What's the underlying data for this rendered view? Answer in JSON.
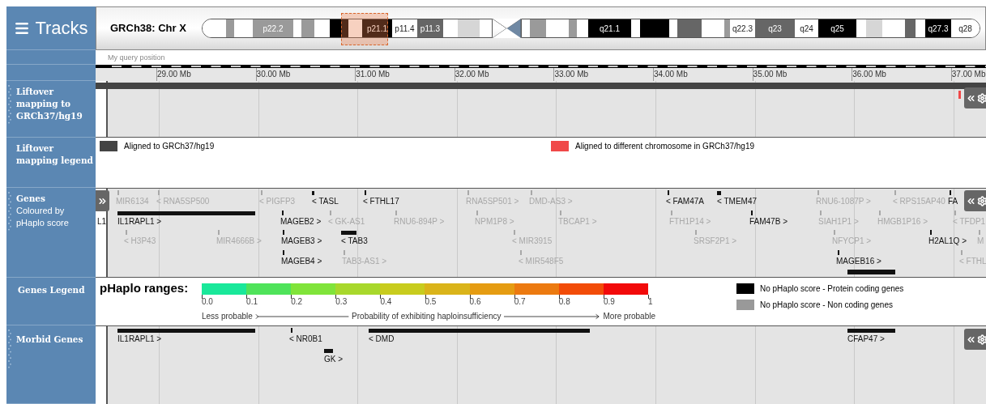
{
  "sidebar": {
    "title": "Tracks"
  },
  "header": {
    "assembly": "GRCh38: Chr X",
    "p_arm": [
      {
        "kind": "gneg"
      },
      {
        "kind": "gpos50"
      },
      {
        "kind": "gneg"
      },
      {
        "kind": "gpos50",
        "label": "p22.2"
      },
      {
        "kind": "gneg"
      },
      {
        "kind": "gpos50"
      },
      {
        "kind": "gneg"
      },
      {
        "kind": "gpos100"
      },
      {
        "kind": "gneg"
      },
      {
        "kind": "gpos100",
        "label": "p21.1"
      },
      {
        "kind": "gneg",
        "label": "p11.4"
      },
      {
        "kind": "gpos75",
        "label": "p11.3"
      },
      {
        "kind": "gneg"
      },
      {
        "kind": "gpos25"
      },
      {
        "kind": "gneg"
      }
    ],
    "q_arm": [
      {
        "kind": "gneg"
      },
      {
        "kind": "gpos50"
      },
      {
        "kind": "gneg"
      },
      {
        "kind": "gpos50"
      },
      {
        "kind": "gneg"
      },
      {
        "kind": "gpos100",
        "label": "q21.1"
      },
      {
        "kind": "gneg"
      },
      {
        "kind": "gpos100"
      },
      {
        "kind": "gneg"
      },
      {
        "kind": "gpos75"
      },
      {
        "kind": "gneg"
      },
      {
        "kind": "gpos50"
      },
      {
        "kind": "gneg",
        "label": "q22.3"
      },
      {
        "kind": "gpos75",
        "label": "q23"
      },
      {
        "kind": "gneg",
        "label": "q24"
      },
      {
        "kind": "gpos100",
        "label": "q25"
      },
      {
        "kind": "gneg"
      },
      {
        "kind": "gpos25"
      },
      {
        "kind": "gneg"
      },
      {
        "kind": "gpos75"
      },
      {
        "kind": "gneg"
      },
      {
        "kind": "gpos100",
        "label": "q27.3"
      },
      {
        "kind": "gneg",
        "label": "q28"
      }
    ]
  },
  "query_label": "My query position",
  "ruler": {
    "ticks": [
      "29.00 Mb",
      "30.00 Mb",
      "31.00 Mb",
      "32.00 Mb",
      "33.00 Mb",
      "34.00 Mb",
      "35.00 Mb",
      "36.00 Mb",
      "37.00 Mb"
    ]
  },
  "liftover": {
    "title": "Liftover mapping to GRCh37/hg19"
  },
  "liftover_legend": {
    "title": "Liftover mapping legend",
    "items": [
      {
        "label": "Aligned to GRCh37/hg19",
        "color": "#444444"
      },
      {
        "label": "Aligned to different chromosome in GRCh37/hg19",
        "color": "#f04848"
      }
    ]
  },
  "genes": {
    "title": "Genes",
    "subtitle": "Coloured by pHaplo score",
    "items": [
      {
        "label": "MIR6134",
        "kind": "noncoding"
      },
      {
        "label": "< RNA5SP500",
        "kind": "noncoding"
      },
      {
        "label": "< PIGFP3",
        "kind": "noncoding"
      },
      {
        "label": "< TASL",
        "kind": "coding"
      },
      {
        "label": "< FTHL17",
        "kind": "coding"
      },
      {
        "label": "RNA5SP501 >",
        "kind": "noncoding"
      },
      {
        "label": "DMD-AS3 >",
        "kind": "noncoding"
      },
      {
        "label": "< FAM47A",
        "kind": "coding"
      },
      {
        "label": "< TMEM47",
        "kind": "coding"
      },
      {
        "label": "RNU6-1087P >",
        "kind": "noncoding"
      },
      {
        "label": "< RPS15AP40",
        "kind": "noncoding"
      },
      {
        "label": "FA",
        "kind": "coding"
      },
      {
        "label": "L1",
        "kind": "coding"
      },
      {
        "label": "IL1RAPL1 >",
        "kind": "coding"
      },
      {
        "label": "MAGEB2 >",
        "kind": "coding"
      },
      {
        "label": "< GK-AS1",
        "kind": "noncoding"
      },
      {
        "label": "RNU6-894P >",
        "kind": "noncoding"
      },
      {
        "label": "NPM1P8 >",
        "kind": "noncoding"
      },
      {
        "label": "TBCAP1 >",
        "kind": "noncoding"
      },
      {
        "label": "FTH1P14 >",
        "kind": "noncoding"
      },
      {
        "label": "FAM47B >",
        "kind": "coding"
      },
      {
        "label": "SIAH1P1 >",
        "kind": "noncoding"
      },
      {
        "label": "HMGB1P16 >",
        "kind": "noncoding"
      },
      {
        "label": "< TFDP1",
        "kind": "noncoding"
      },
      {
        "label": "< H3P43",
        "kind": "noncoding"
      },
      {
        "label": "MIR4666B >",
        "kind": "noncoding"
      },
      {
        "label": "MAGEB3 >",
        "kind": "coding"
      },
      {
        "label": "< TAB3",
        "kind": "coding"
      },
      {
        "label": "< MIR3915",
        "kind": "noncoding"
      },
      {
        "label": "SRSF2P1 >",
        "kind": "noncoding"
      },
      {
        "label": "NFYCP1 >",
        "kind": "noncoding"
      },
      {
        "label": "H2AL1Q >",
        "kind": "coding"
      },
      {
        "label": "M",
        "kind": "noncoding"
      },
      {
        "label": "MAGEB4 >",
        "kind": "coding"
      },
      {
        "label": "TAB3-AS1 >",
        "kind": "noncoding"
      },
      {
        "label": "< MIR548F5",
        "kind": "noncoding"
      },
      {
        "label": "MAGEB16 >",
        "kind": "coding"
      },
      {
        "label": "< FTHL",
        "kind": "noncoding"
      }
    ]
  },
  "genes_legend": {
    "title": "Genes Legend",
    "heading": "pHaplo ranges:",
    "ranges": [
      {
        "color": "#19e89a"
      },
      {
        "color": "#4fe35a"
      },
      {
        "color": "#80e43a"
      },
      {
        "color": "#a8d82c"
      },
      {
        "color": "#c8cc1e"
      },
      {
        "color": "#dab41a"
      },
      {
        "color": "#e59c12"
      },
      {
        "color": "#ec7a10"
      },
      {
        "color": "#f24c08"
      },
      {
        "color": "#f20a0a"
      }
    ],
    "ticks": [
      "0.0",
      "0.1",
      "0.2",
      "0.3",
      "0.4",
      "0.5",
      "0.6",
      "0.7",
      "0.8",
      "0.9",
      "1"
    ],
    "less": "Less probable",
    "axis": "Probability of exhibiting haploinsufficiency",
    "more": "More probable",
    "keys": [
      {
        "label": "No pHaplo score - Protein coding genes",
        "color": "#000000"
      },
      {
        "label": "No pHaplo score - Non coding genes",
        "color": "#999999"
      }
    ]
  },
  "morbid": {
    "title": "Morbid Genes",
    "items": [
      {
        "label": "IL1RAPL1 >"
      },
      {
        "label": "< NR0B1"
      },
      {
        "label": "GK >"
      },
      {
        "label": "< DMD"
      },
      {
        "label": "CFAP47 >"
      }
    ]
  }
}
